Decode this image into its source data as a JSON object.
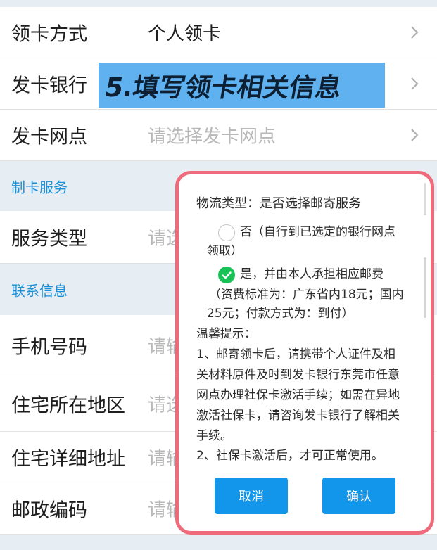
{
  "rows_top": [
    {
      "label": "领卡方式",
      "value": "个人领卡",
      "placeholder": false
    },
    {
      "label": "发卡银行",
      "value": "",
      "placeholder": false
    },
    {
      "label": "发卡网点",
      "value": "请选择发卡网点",
      "placeholder": true
    }
  ],
  "sections": {
    "card_service": "制卡服务",
    "contact_info": "联系信息"
  },
  "rows_service": [
    {
      "label": "服务类型",
      "value": "请选",
      "placeholder": true
    }
  ],
  "rows_contact": [
    {
      "label": "手机号码",
      "value": "请输",
      "placeholder": true
    },
    {
      "label": "住宅所在地区",
      "value": "请选",
      "placeholder": true
    },
    {
      "label": "住宅详细地址",
      "value": "请输",
      "placeholder": true
    },
    {
      "label": "邮政编码",
      "value": "请输",
      "placeholder": true
    }
  ],
  "banner": {
    "text": "5.填写领卡相关信息"
  },
  "modal": {
    "heading": "物流类型：是否选择邮寄服务",
    "option_no_line1": "否（自行到已选定的银行网点",
    "option_no_line2": "领取）",
    "option_yes_line1": "是，并由本人承担相应邮费",
    "option_yes_line2": "（资费标准为：广东省内18元；国内",
    "option_yes_line3": "25元；付款方式为：到付）",
    "tips_title": "温馨提示：",
    "tip1_line1": "1、邮寄领卡后，请携带个人证件及相",
    "tip1_line2": "关材料原件及时到发卡银行东莞市任意",
    "tip1_line3": "网点办理社保卡激活手续；如需在异地",
    "tip1_line4": "激活社保卡，请咨询发卡银行了解相关",
    "tip1_line5": "手续。",
    "tip2": "2、社保卡激活后，才可正常使用。",
    "cancel_label": "取消",
    "confirm_label": "确认",
    "selected_option": "yes"
  },
  "colors": {
    "accent": "#1296ec",
    "section_title": "#1c8fd6",
    "highlight_frame": "#ef6b7c",
    "check": "#19c157",
    "banner": "#5fb1ef"
  }
}
